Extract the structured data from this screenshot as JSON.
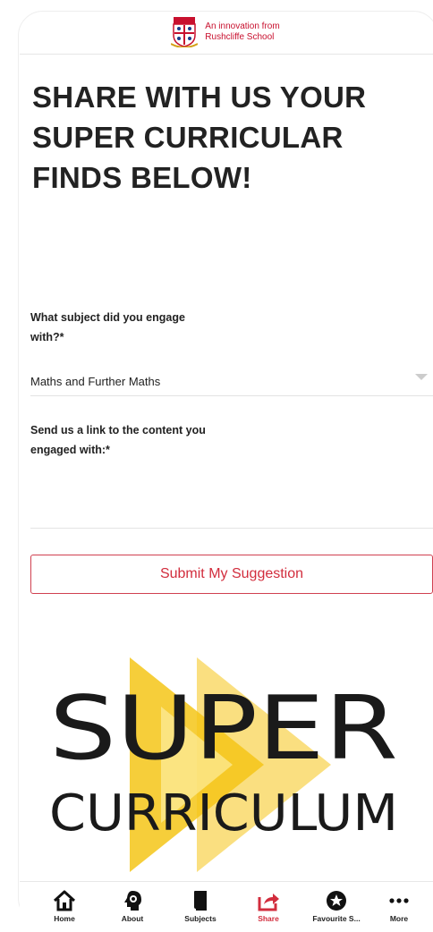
{
  "header": {
    "tagline_line1": "An innovation from",
    "tagline_line2": "Rushcliffe School"
  },
  "page": {
    "title": "SHARE WITH US YOUR SUPER CURRICULAR FINDS BELOW!"
  },
  "form": {
    "subject_label": "What subject did you engage with?*",
    "subject_value": "Maths and Further Maths",
    "link_label": "Send us a link to the content you engaged with:*",
    "link_value": "",
    "submit_label": "Submit My Suggestion"
  },
  "logo": {
    "line1": "SUPER",
    "line2": "CURRICULUM"
  },
  "tabs": [
    {
      "label": "Home",
      "icon": "home-icon",
      "active": false
    },
    {
      "label": "About",
      "icon": "head-gear-icon",
      "active": false
    },
    {
      "label": "Subjects",
      "icon": "book-icon",
      "active": false
    },
    {
      "label": "Share",
      "icon": "share-icon",
      "active": true
    },
    {
      "label": "Favourite S...",
      "icon": "star-icon",
      "active": false
    },
    {
      "label": "More",
      "icon": "more-icon",
      "active": false
    }
  ],
  "colors": {
    "accent": "#d22d3d",
    "logo_yellow": "#f5c518",
    "text": "#222222"
  }
}
